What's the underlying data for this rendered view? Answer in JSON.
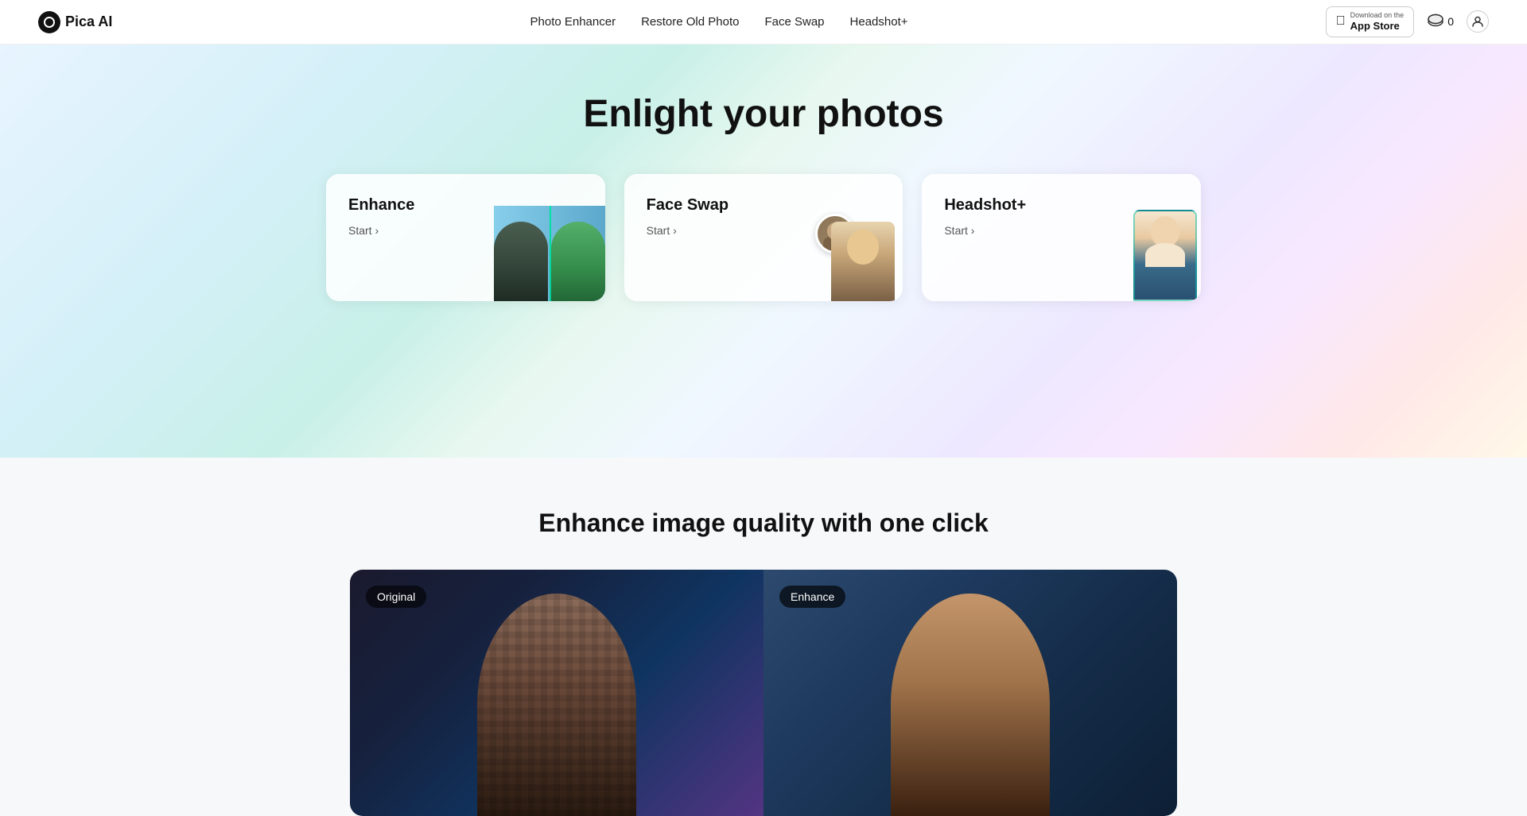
{
  "nav": {
    "logo_text": "Pica AI",
    "links": [
      {
        "id": "photo-enhancer",
        "label": "Photo Enhancer"
      },
      {
        "id": "restore-old-photo",
        "label": "Restore Old Photo"
      },
      {
        "id": "face-swap",
        "label": "Face Swap"
      },
      {
        "id": "headshot-plus",
        "label": "Headshot+"
      }
    ],
    "app_store": {
      "prefix": "Download on the",
      "name": "App Store"
    },
    "credits": "0",
    "user_icon_label": "user"
  },
  "hero": {
    "title": "Enlight your photos",
    "cards": [
      {
        "id": "enhance",
        "title": "Enhance",
        "start_label": "Start ›"
      },
      {
        "id": "face-swap",
        "title": "Face Swap",
        "start_label": "Start ›"
      },
      {
        "id": "headshot",
        "title": "Headshot+",
        "start_label": "Start ›"
      }
    ]
  },
  "section_two": {
    "title": "Enhance image quality with one click",
    "original_badge": "Original",
    "enhance_badge": "Enhance"
  }
}
